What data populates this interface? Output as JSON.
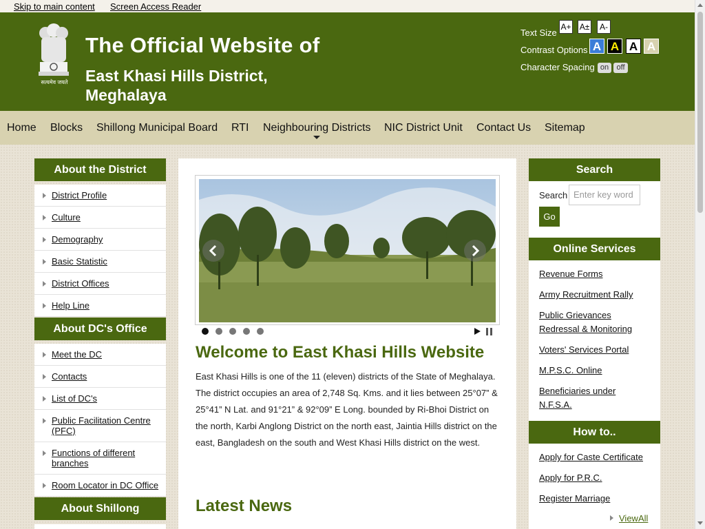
{
  "skip_links": [
    "Skip to main content",
    "Screen Access Reader"
  ],
  "header": {
    "title": "The Official Website of",
    "subtitle": "East Khasi Hills District, Meghalaya",
    "text_size_label": "Text Size",
    "text_size_buttons": [
      "A+",
      "A±",
      "A-"
    ],
    "contrast_label": "Contrast Options",
    "contrast_buttons": [
      "A",
      "A",
      "A",
      "A"
    ],
    "spacing_label": "Character Spacing",
    "spacing_on": "on",
    "spacing_off": "off",
    "emblem_caption": "सत्यमेव जयते"
  },
  "nav": [
    "Home",
    "Blocks",
    "Shillong Municipal Board",
    "RTI",
    "Neighbouring Districts",
    "NIC District Unit",
    "Contact Us",
    "Sitemap"
  ],
  "left": {
    "about_district": {
      "title": "About the District",
      "items": [
        "District Profile",
        "Culture",
        "Demography",
        "Basic Statistic",
        "District Offices",
        "Help Line"
      ]
    },
    "about_dc": {
      "title": "About DC's Office",
      "items": [
        "Meet the DC",
        "Contacts",
        "List of DC's",
        "Public Facilitation Centre (PFC)",
        "Functions of different branches",
        "Room Locator in DC Office"
      ]
    },
    "about_shillong": {
      "title": "About Shillong"
    }
  },
  "main": {
    "welcome_title": "Welcome to East Khasi Hills Website",
    "welcome_text": "East Khasi Hills is one of the 11 (eleven) districts of the State of Meghalaya. The district occupies an area of 2,748 Sq. Kms. and it lies between 25°07” & 25°41” N Lat. and 91°21” & 92°09” E Long. bounded by Ri-Bhoi District on the north, Karbi Anglong District on the north east, Jaintia Hills district on the east, Bangladesh on the south and West Khasi Hills district on the west.",
    "news_title": "Latest News",
    "slide_count": 5,
    "active_slide": 1
  },
  "right": {
    "search": {
      "title": "Search",
      "label": "Search",
      "placeholder": "Enter key word",
      "button": "Go"
    },
    "online_services": {
      "title": "Online Services",
      "items": [
        "Revenue Forms",
        "Army Recruitment Rally",
        "Public Grievances Redressal & Monitoring",
        "Voters' Services Portal",
        "M.P.S.C. Online",
        "Beneficiaries under N.F.S.A."
      ]
    },
    "how_to": {
      "title": "How to..",
      "items": [
        "Apply for Caste Certificate",
        "Apply for P.R.C.",
        "Register Marriage"
      ],
      "view_all": "ViewAll"
    }
  },
  "colors": {
    "brand_green": "#4a6810",
    "nav_bg": "#d8d2b0",
    "page_bg": "#e9e3d6"
  }
}
